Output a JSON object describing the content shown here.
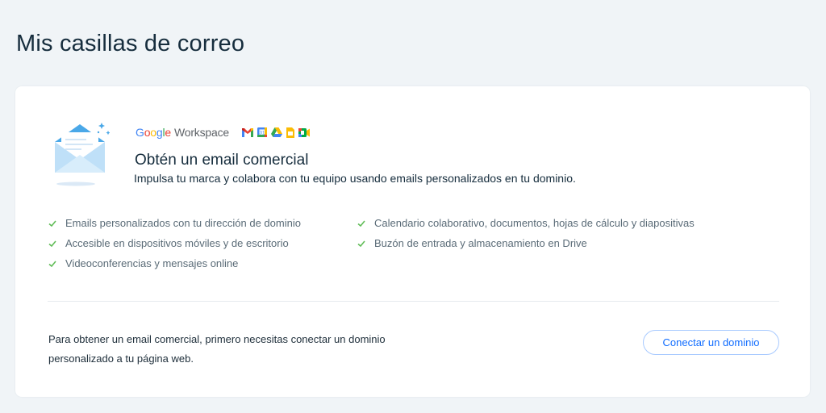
{
  "page": {
    "title": "Mis casillas de correo"
  },
  "promo": {
    "brand": {
      "google_letters": [
        {
          "char": "G",
          "color": "#4285F4"
        },
        {
          "char": "o",
          "color": "#EA4335"
        },
        {
          "char": "o",
          "color": "#FBBC05"
        },
        {
          "char": "g",
          "color": "#4285F4"
        },
        {
          "char": "l",
          "color": "#34A853"
        },
        {
          "char": "e",
          "color": "#EA4335"
        }
      ],
      "product": "Workspace",
      "app_icons": [
        "gmail-icon",
        "calendar-icon",
        "drive-icon",
        "docs-icon",
        "meet-icon"
      ]
    },
    "title": "Obtén un email comercial",
    "subtitle": "Impulsa tu marca y colabora con tu equipo usando emails personalizados en tu dominio.",
    "features_left": [
      "Emails personalizados con tu dirección de dominio",
      "Accesible en dispositivos móviles y de escritorio",
      "Videoconferencias y mensajes online"
    ],
    "features_right": [
      "Calendario colaborativo, documentos, hojas de cálculo y diapositivas",
      "Buzón de entrada y almacenamiento en Drive"
    ],
    "check_color": "#60bc57"
  },
  "footer": {
    "notice": "Para obtener un email comercial, primero necesitas conectar un dominio personalizado a tu página web.",
    "connect_label": "Conectar un dominio",
    "accent": "#116dff"
  }
}
